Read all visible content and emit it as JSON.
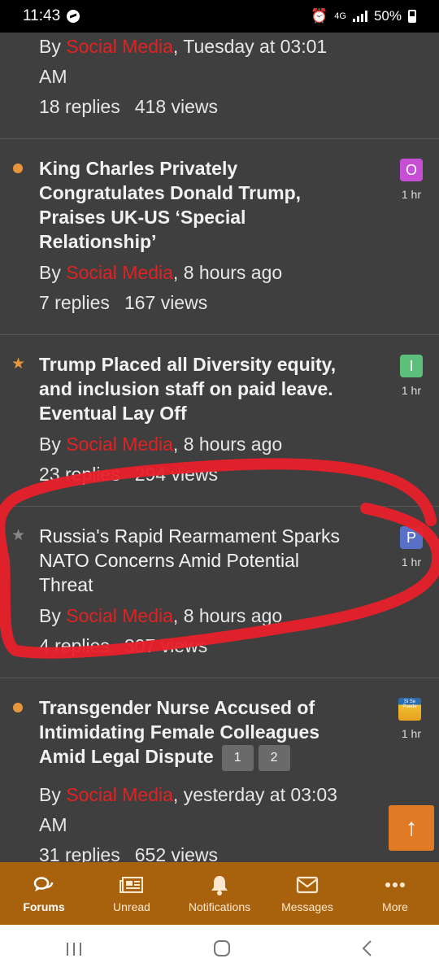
{
  "status_bar": {
    "time": "11:43",
    "network": "4G",
    "battery": "50%"
  },
  "threads": [
    {
      "title_lines": [],
      "author": "Social Media",
      "date_lines": [
        ", Tuesday at 03:01",
        "AM"
      ],
      "replies": "18 replies",
      "views": "418 views"
    },
    {
      "marker": "dot",
      "title_lines": [
        "King Charles Privately",
        "Congratulates Donald Trump,",
        "Praises UK-US ‘Special",
        "Relationship’"
      ],
      "author": "Social Media",
      "date": ", 8 hours ago",
      "replies": "7 replies",
      "views": "167 views",
      "avatar_letter": "O",
      "avatar_color": "#c74fd6",
      "time": "1 hr"
    },
    {
      "marker": "star-orange",
      "title_lines": [
        "Trump Placed all Diversity equity,",
        "and inclusion staff on paid leave.",
        "Eventual Lay Off"
      ],
      "author": "Social Media",
      "date": ", 8 hours ago",
      "replies": "23 replies",
      "views": "294 views",
      "avatar_letter": "I",
      "avatar_color": "#5cc07a",
      "time": "1 hr"
    },
    {
      "marker": "star-grey",
      "title_lines": [
        "Russia's Rapid Rearmament Sparks",
        "NATO Concerns Amid Potential",
        "Threat"
      ],
      "author": "Social Media",
      "date": ", 8 hours ago",
      "replies": "4 replies",
      "views": "307 views",
      "avatar_letter": "P",
      "avatar_color": "#5a6fc8",
      "time": "1 hr"
    },
    {
      "marker": "dot",
      "title_lines": [
        "Transgender Nurse Accused of",
        "Intimidating Female Colleagues",
        "Amid Legal Dispute"
      ],
      "pages": [
        "1",
        "2"
      ],
      "author": "Social Media",
      "date_lines": [
        ", yesterday at 03:03",
        "AM"
      ],
      "replies": "31 replies",
      "views": "652 views",
      "avatar_text": "Si Se Puede",
      "time": "1 hr"
    }
  ],
  "tabs": [
    {
      "label": "Forums",
      "icon": "forums-icon"
    },
    {
      "label": "Unread",
      "icon": "newspaper-icon"
    },
    {
      "label": "Notifications",
      "icon": "bell-icon"
    },
    {
      "label": "Messages",
      "icon": "envelope-icon"
    },
    {
      "label": "More",
      "icon": "more-icon"
    }
  ],
  "colors": {
    "background": "#3f3f3f",
    "accent": "#e07a24",
    "tabbar": "#a8620e",
    "author": "#e12222",
    "annotation": "#e8202a"
  }
}
